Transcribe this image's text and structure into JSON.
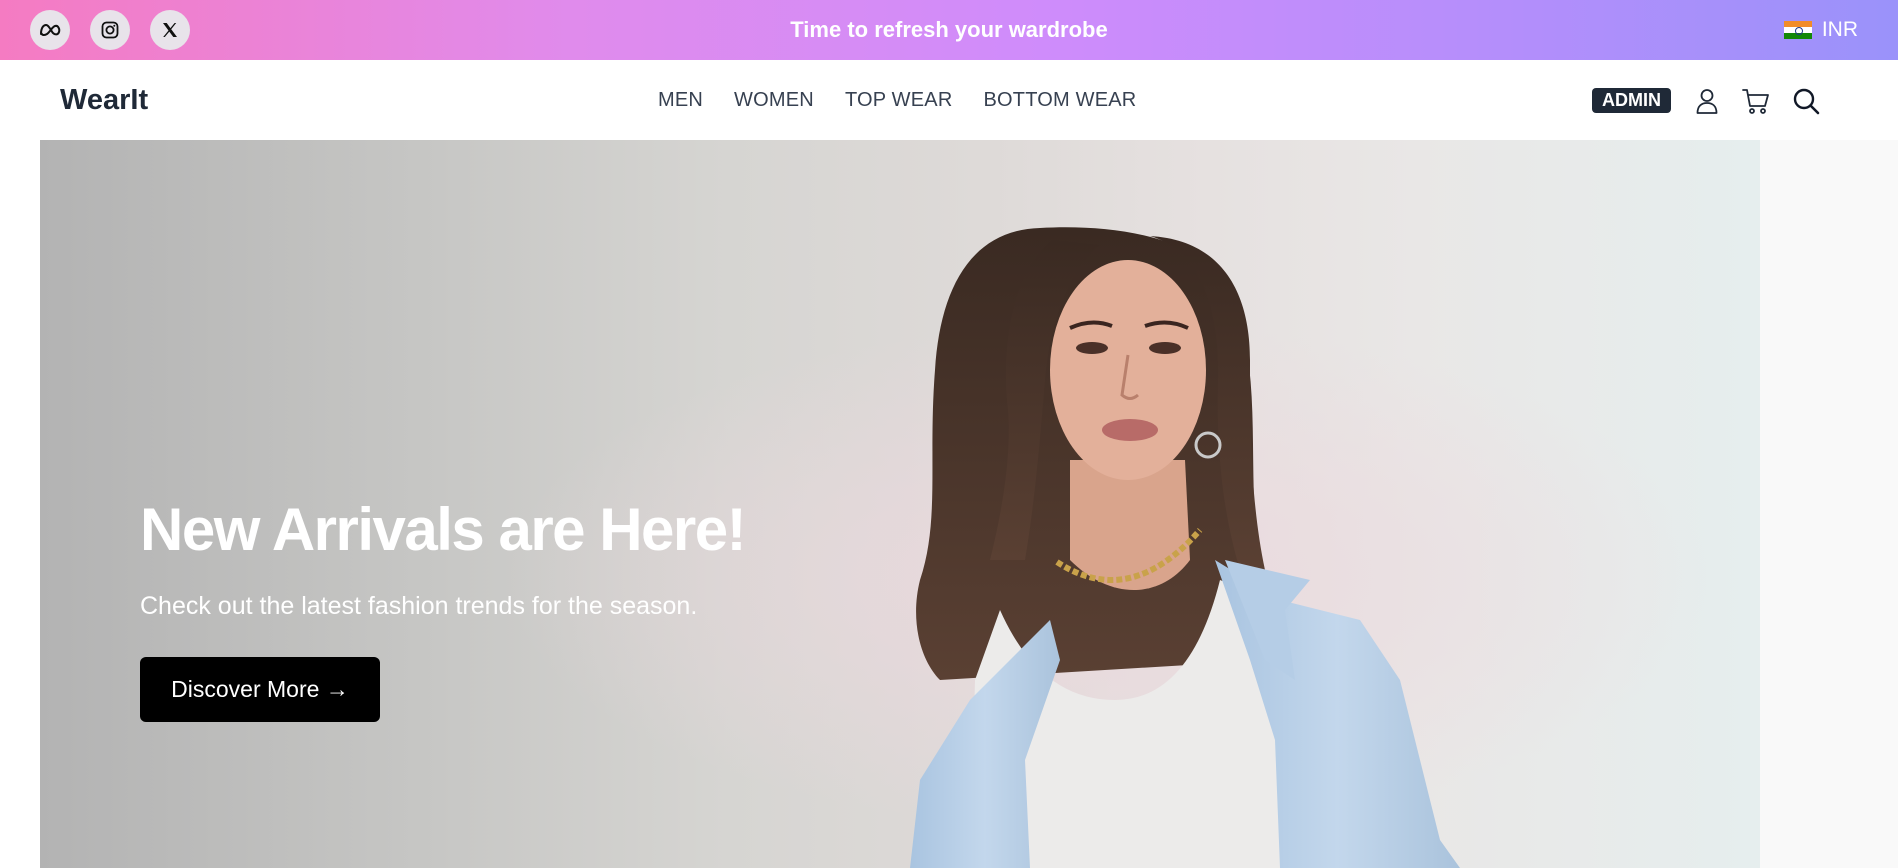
{
  "topbar": {
    "promo_text": "Time to refresh your wardrobe",
    "socials": [
      {
        "icon": "meta-icon",
        "label": "Meta"
      },
      {
        "icon": "instagram-icon",
        "label": "Instagram"
      },
      {
        "icon": "x-icon",
        "label": "X"
      }
    ],
    "currency": {
      "flag": "india-flag-icon",
      "code": "INR"
    },
    "gradient": [
      "#f57bc2",
      "#cf8cfb",
      "#9a92fa"
    ]
  },
  "nav": {
    "logo": "WearIt",
    "menu": [
      "MEN",
      "WOMEN",
      "TOP WEAR",
      "BOTTOM WEAR"
    ],
    "admin_label": "ADMIN",
    "icons": [
      "user-icon",
      "cart-icon",
      "search-icon"
    ]
  },
  "hero": {
    "headline": "New Arrivals are Here!",
    "subline": "Check out the latest fashion trends for the season.",
    "cta_label": "Discover More →",
    "image_subject": "model in light blue blazer and white top"
  }
}
